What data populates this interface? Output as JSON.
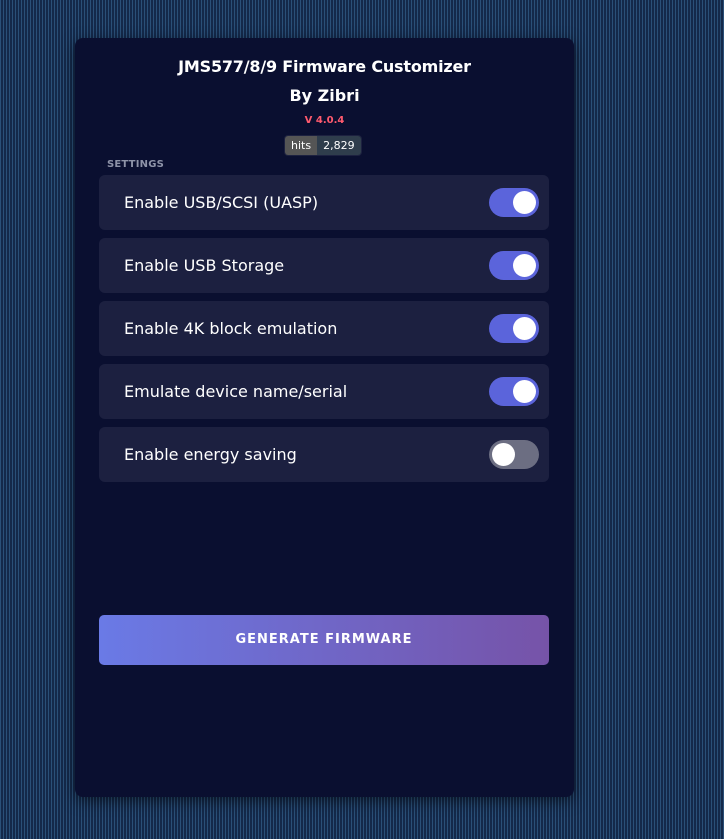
{
  "header": {
    "title": "JMS577/8/9 Firmware Customizer",
    "byline": "By Zibri",
    "version": "V 4.0.4"
  },
  "hits_badge": {
    "label": "hits",
    "count": "2,829"
  },
  "settings": {
    "section_label": "SETTINGS",
    "items": [
      {
        "label": "Enable USB/SCSI (UASP)",
        "enabled": true
      },
      {
        "label": "Enable USB Storage",
        "enabled": true
      },
      {
        "label": "Enable 4K block emulation",
        "enabled": true
      },
      {
        "label": "Emulate device name/serial",
        "enabled": true
      },
      {
        "label": "Enable energy saving",
        "enabled": false
      }
    ]
  },
  "actions": {
    "generate_label": "GENERATE FIRMWARE"
  },
  "colors": {
    "card_background": "#0a0f30",
    "row_background": "#1c2040",
    "toggle_on": "#5b64db",
    "toggle_off": "#6c6e82",
    "version_accent": "#ff5a6e",
    "button_gradient_start": "#6a7ae6",
    "button_gradient_end": "#7653a8"
  }
}
